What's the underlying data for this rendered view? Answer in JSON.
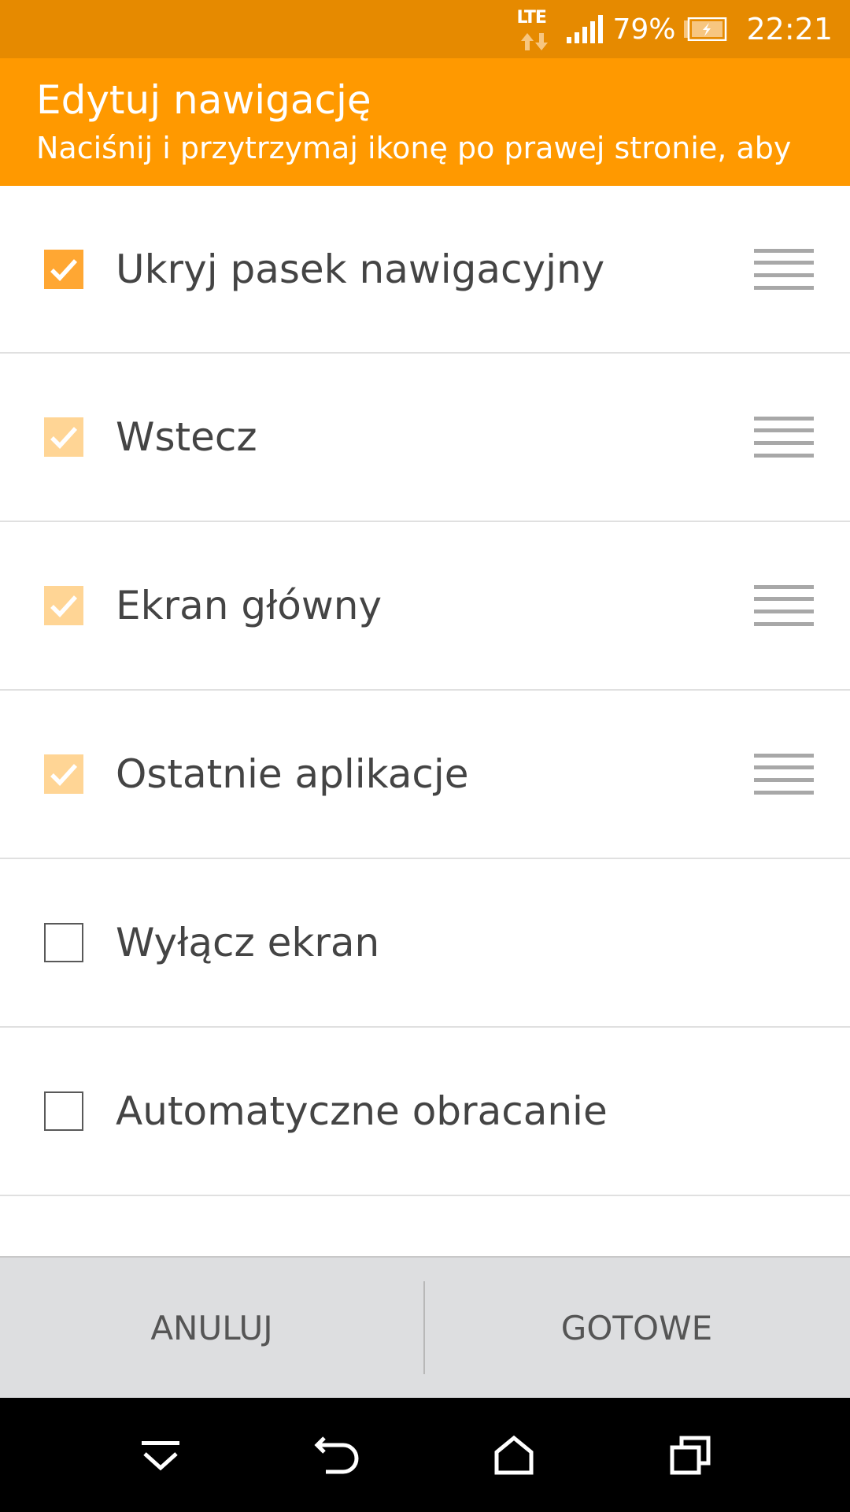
{
  "status_bar": {
    "network": "LTE",
    "battery_percent": "79%",
    "time": "22:21",
    "icons": [
      "lte-data-icon",
      "signal-icon",
      "battery-charging-icon"
    ]
  },
  "header": {
    "title": "Edytuj nawigację",
    "subtitle": "Naciśnij i przytrzymaj ikonę po prawej stronie, aby"
  },
  "items": [
    {
      "label": "Ukryj pasek nawigacyjny",
      "checked": true
    },
    {
      "label": "Wstecz",
      "checked": true
    },
    {
      "label": "Ekran główny",
      "checked": true
    },
    {
      "label": "Ostatnie aplikacje",
      "checked": true
    },
    {
      "label": "Wyłącz ekran",
      "checked": false
    },
    {
      "label": "Automatyczne obracanie",
      "checked": false
    }
  ],
  "actions": {
    "cancel_label": "ANULUJ",
    "done_label": "GOTOWE"
  },
  "nav_bar": {
    "icons": [
      "hide-nav-icon",
      "back-icon",
      "home-icon",
      "recents-icon"
    ]
  },
  "colors": {
    "status_bar": "#e68a00",
    "header": "#ff9900",
    "checkbox_checked": "#ffa733",
    "checkbox_checked_disabled": "#ffd595",
    "action_bar": "#dddee0"
  }
}
